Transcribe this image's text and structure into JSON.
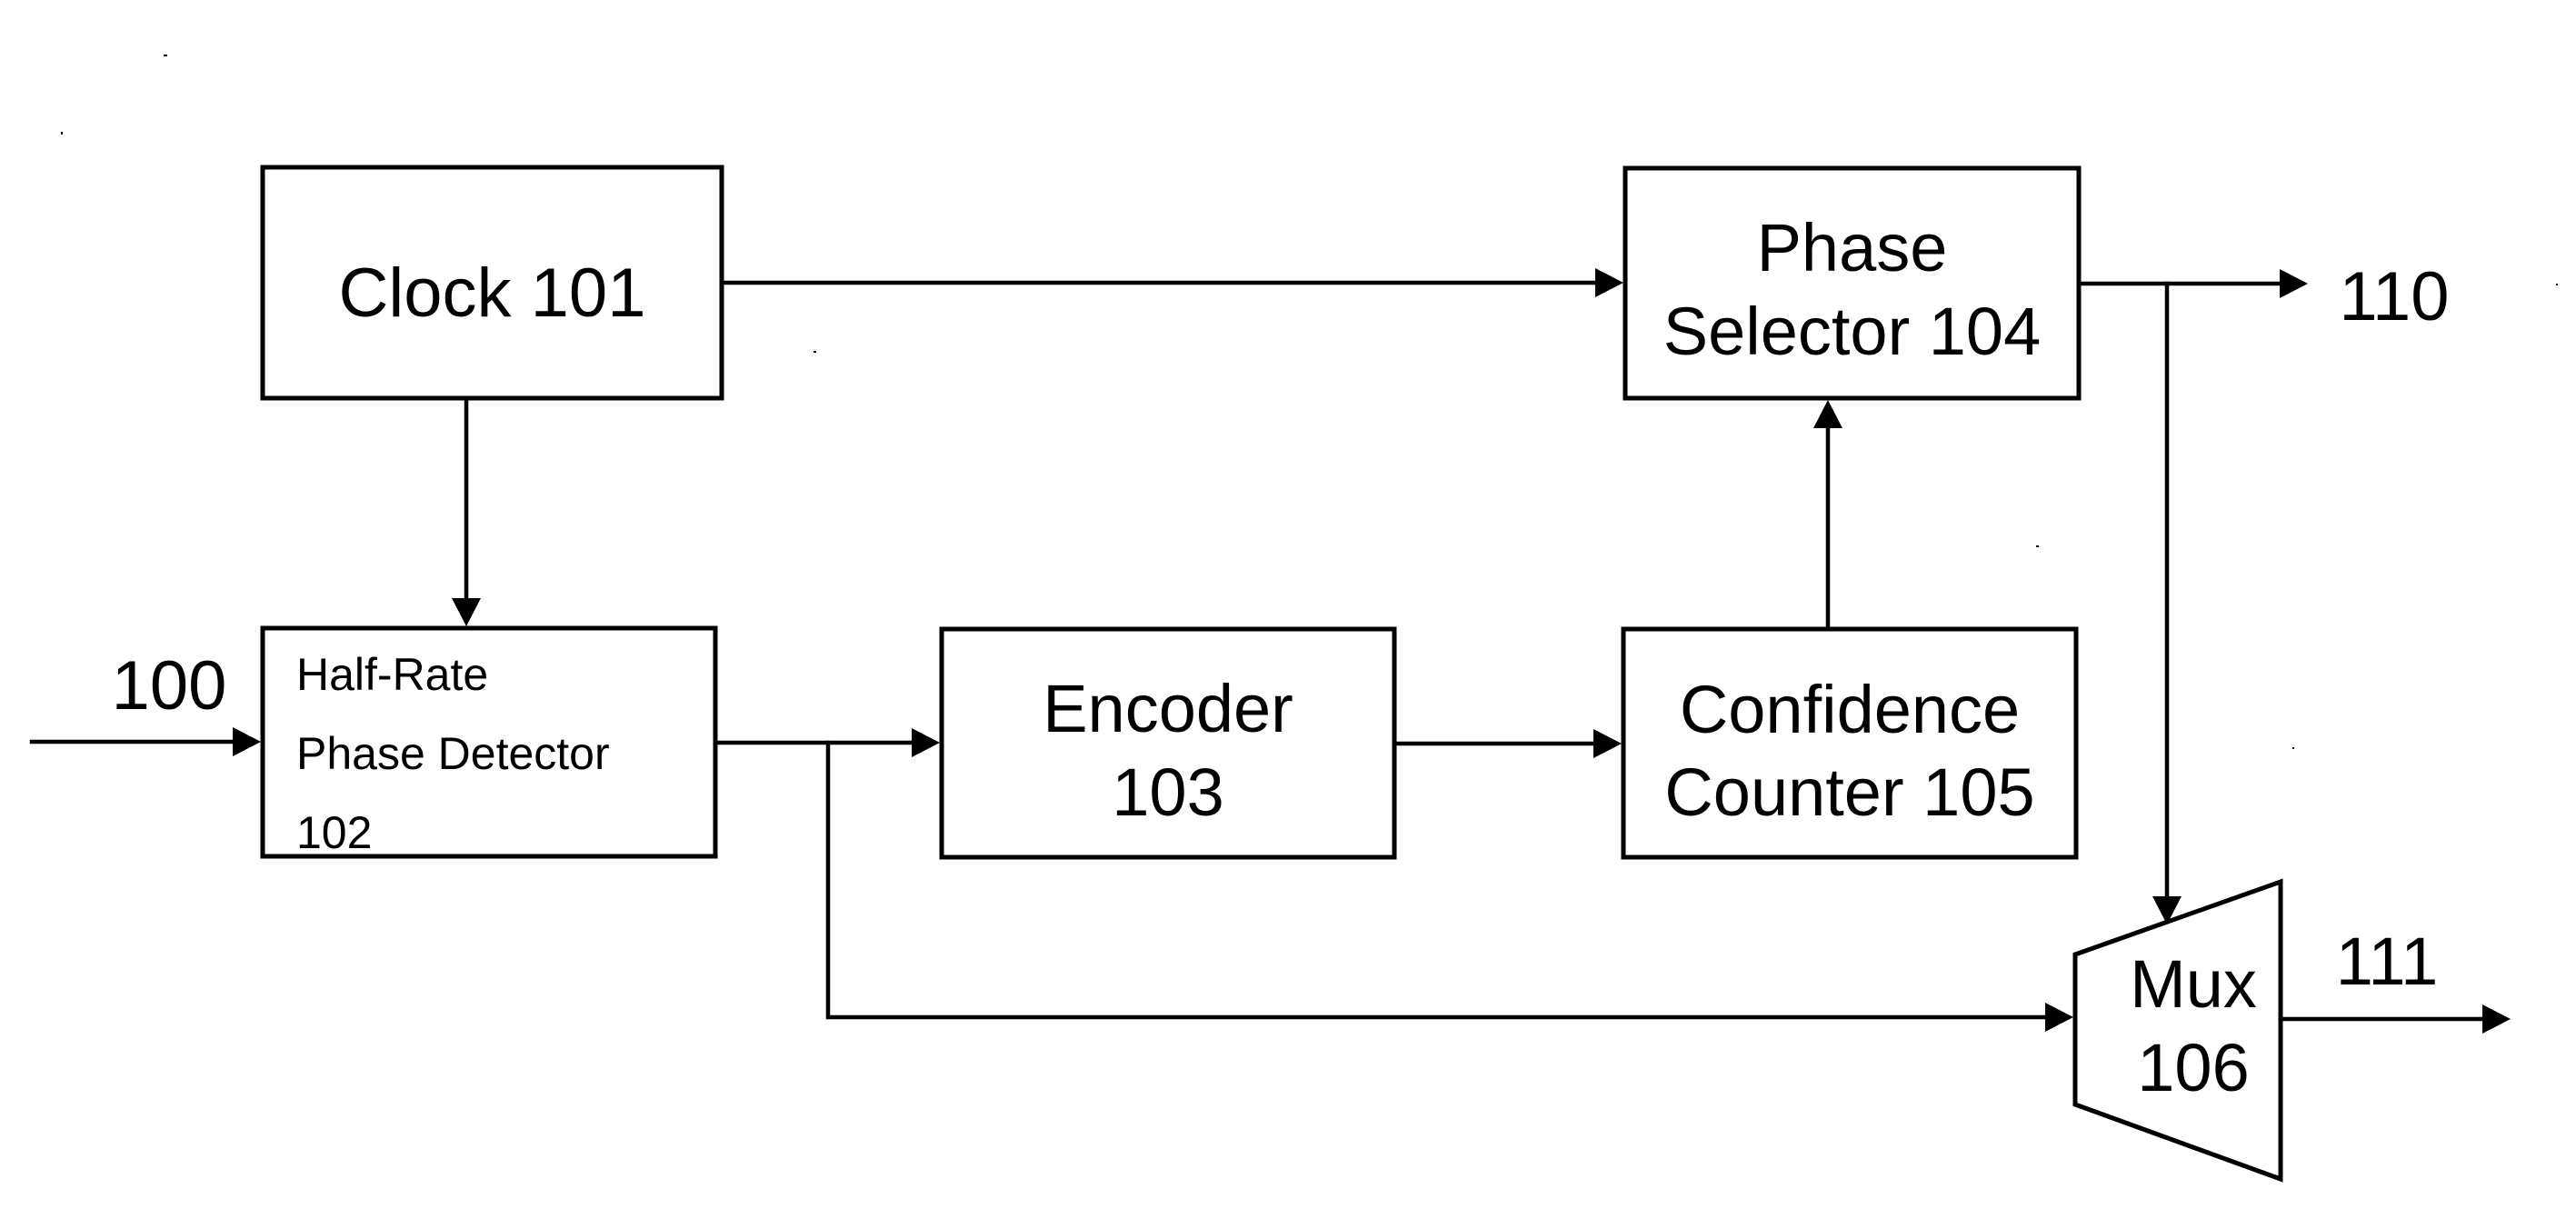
{
  "figure": {
    "type": "block-diagram",
    "colors": {
      "ink": "#000000",
      "background": "#ffffff"
    }
  },
  "blocks": [
    {
      "id": "clock",
      "name": "clock-block",
      "shape": "rect",
      "lines": [
        "Clock 101"
      ]
    },
    {
      "id": "detector",
      "name": "half-rate-phase-detector-block",
      "shape": "rect",
      "lines": [
        "Half-Rate",
        "Phase Detector",
        "102"
      ]
    },
    {
      "id": "encoder",
      "name": "encoder-block",
      "shape": "rect",
      "lines": [
        "Encoder",
        "103"
      ]
    },
    {
      "id": "selector",
      "name": "phase-selector-block",
      "shape": "rect",
      "lines": [
        "Phase",
        "Selector 104"
      ]
    },
    {
      "id": "counter",
      "name": "confidence-counter-block",
      "shape": "rect",
      "lines": [
        "Confidence",
        "Counter 105"
      ]
    },
    {
      "id": "mux",
      "name": "mux-block",
      "shape": "trapezoid",
      "lines": [
        "Mux",
        "106"
      ]
    }
  ],
  "signals": [
    {
      "id": "in100",
      "name": "signal-label-100",
      "text": "100"
    },
    {
      "id": "out110",
      "name": "signal-label-110",
      "text": "110"
    },
    {
      "id": "out111",
      "name": "signal-label-111",
      "text": "111"
    }
  ],
  "edges": [
    {
      "id": "e-in",
      "name": "edge-input-to-detector",
      "from": "input 100",
      "to": "detector"
    },
    {
      "id": "e-clk-det",
      "name": "edge-clock-to-detector",
      "from": "clock",
      "to": "detector"
    },
    {
      "id": "e-clk-sel",
      "name": "edge-clock-to-selector",
      "from": "clock",
      "to": "selector"
    },
    {
      "id": "e-det-enc",
      "name": "edge-detector-to-encoder",
      "from": "detector",
      "to": "encoder"
    },
    {
      "id": "e-det-mux",
      "name": "edge-detector-to-mux",
      "from": "detector",
      "to": "mux"
    },
    {
      "id": "e-enc-cnt",
      "name": "edge-encoder-to-counter",
      "from": "encoder",
      "to": "counter"
    },
    {
      "id": "e-cnt-sel",
      "name": "edge-counter-to-selector",
      "from": "counter",
      "to": "selector"
    },
    {
      "id": "e-sel-out",
      "name": "edge-selector-to-output-110",
      "from": "selector",
      "to": "output 110"
    },
    {
      "id": "e-sel-mux",
      "name": "edge-selector-to-mux",
      "from": "selector",
      "to": "mux"
    },
    {
      "id": "e-mux-out",
      "name": "edge-mux-to-output-111",
      "from": "mux",
      "to": "output 111"
    }
  ]
}
